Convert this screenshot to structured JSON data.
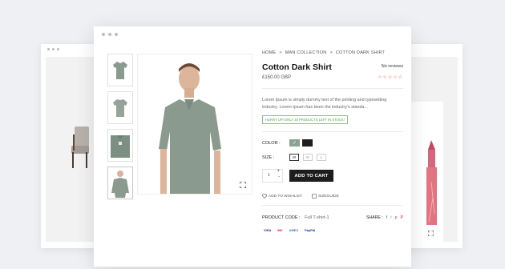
{
  "breadcrumb": [
    "HOME",
    "MAN COLLECTION",
    "COTTON DARK SHIRT"
  ],
  "breadcrumb_separator": ">",
  "product": {
    "title": "Cotton Dark Shirt",
    "reviews": "No reviews",
    "price": "£150.00 GBP",
    "stars": "☆☆☆☆☆",
    "description": "Lorem Ipsum is simply dummy text of the printing and typesetting industry. Lorem Ipsum has been the industry's standa...",
    "stock_badge": "HURRY UP! ONLY 20 PRODUCTS LEFT IN STOCK!"
  },
  "options": {
    "color_label": "COLOR :",
    "colors": [
      "#8aa393",
      "#1f1f1f"
    ],
    "size_label": "SIZE :",
    "sizes": [
      "M",
      "N",
      "L"
    ]
  },
  "cart": {
    "qty": "1",
    "plus": "+",
    "minus": "-",
    "button": "ADD TO CART"
  },
  "links": {
    "wishlist": "ADD TO WISHLIST",
    "sizeguide": "SIZEGUIDE"
  },
  "meta": {
    "code_label": "PRODUCT CODE :",
    "code_value": "Full T-shirt-1",
    "share_label": "SHARE :"
  },
  "share_icons": [
    "f",
    "t",
    "p",
    "P"
  ],
  "payments": [
    "VISA",
    "MC",
    "AMEX",
    "PayPal"
  ],
  "colors": {
    "accent_star": "#e0554a",
    "button_bg": "#1d1d1d",
    "stock_green": "#5d9b57"
  }
}
